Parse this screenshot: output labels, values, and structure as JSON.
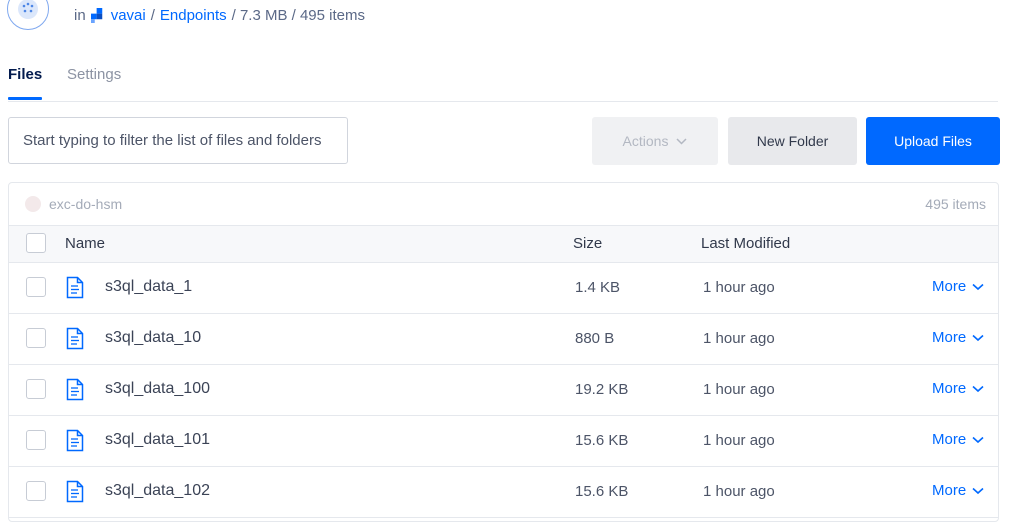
{
  "breadcrumb": {
    "prefix": "in",
    "project": "vavai",
    "sep1": "/",
    "section": "Endpoints",
    "meta": "/ 7.3 MB / 495 items"
  },
  "tabs": [
    {
      "label": "Files",
      "active": true
    },
    {
      "label": "Settings",
      "active": false
    }
  ],
  "toolbar": {
    "filter_placeholder": "Start typing to filter the list of files and folders",
    "actions_label": "Actions",
    "new_folder_label": "New Folder",
    "upload_label": "Upload Files"
  },
  "panel": {
    "space_name": "exc-do-hsm",
    "count": "495 items"
  },
  "columns": {
    "name": "Name",
    "size": "Size",
    "modified": "Last Modified"
  },
  "files": [
    {
      "name": "s3ql_data_1",
      "size": "1.4 KB",
      "modified": "1 hour ago",
      "action": "More"
    },
    {
      "name": "s3ql_data_10",
      "size": "880 B",
      "modified": "1 hour ago",
      "action": "More"
    },
    {
      "name": "s3ql_data_100",
      "size": "19.2 KB",
      "modified": "1 hour ago",
      "action": "More"
    },
    {
      "name": "s3ql_data_101",
      "size": "15.6 KB",
      "modified": "1 hour ago",
      "action": "More"
    },
    {
      "name": "s3ql_data_102",
      "size": "15.6 KB",
      "modified": "1 hour ago",
      "action": "More"
    }
  ],
  "colors": {
    "accent": "#0069ff",
    "text_dark": "#031b4e"
  }
}
